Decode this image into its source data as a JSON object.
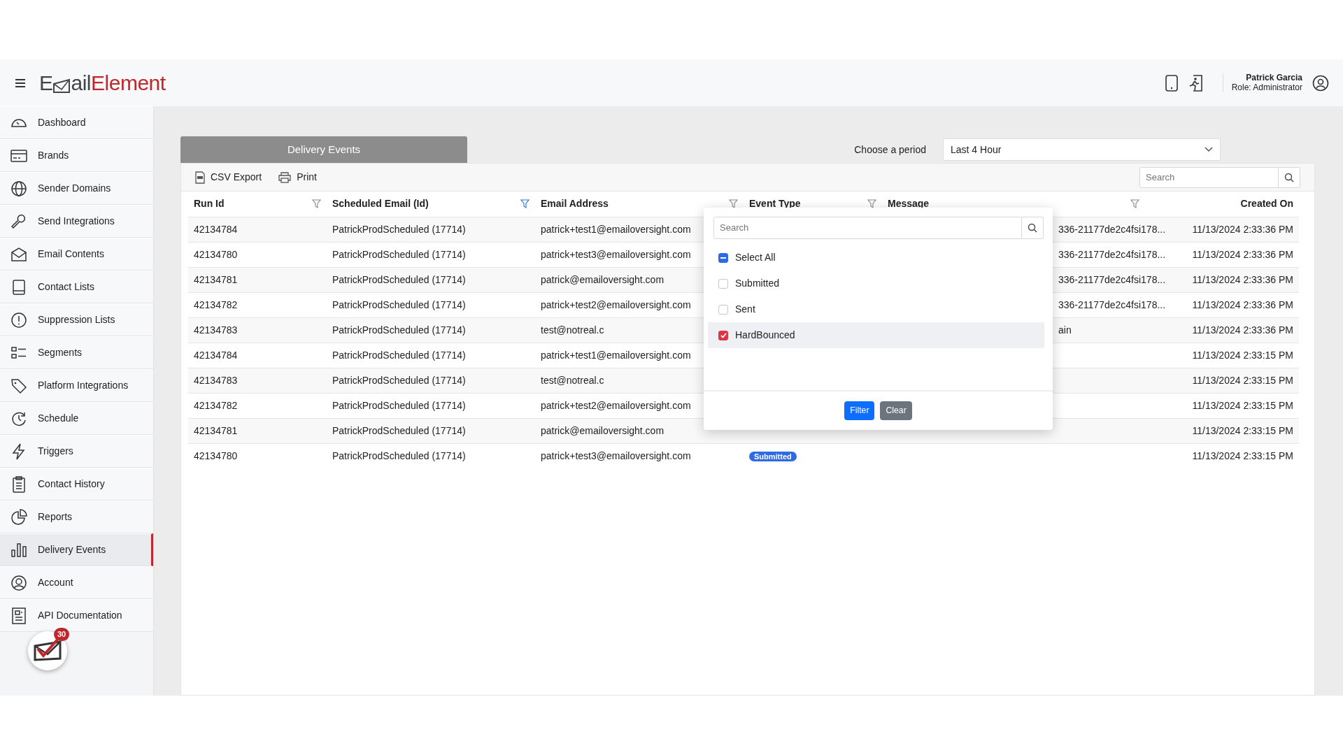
{
  "header": {
    "logo": {
      "start": "E",
      "middle": "ail",
      "end": "Element"
    },
    "user": {
      "name": "Patrick Garcia",
      "role": "Role: Administrator"
    }
  },
  "sidebar": {
    "items": [
      {
        "label": "Dashboard",
        "selected": false
      },
      {
        "label": "Brands",
        "selected": false
      },
      {
        "label": "Sender Domains",
        "selected": false
      },
      {
        "label": "Send Integrations",
        "selected": false
      },
      {
        "label": "Email Contents",
        "selected": false
      },
      {
        "label": "Contact Lists",
        "selected": false
      },
      {
        "label": "Suppression Lists",
        "selected": false
      },
      {
        "label": "Segments",
        "selected": false
      },
      {
        "label": "Platform Integrations",
        "selected": false
      },
      {
        "label": "Schedule",
        "selected": false
      },
      {
        "label": "Triggers",
        "selected": false
      },
      {
        "label": "Contact History",
        "selected": false
      },
      {
        "label": "Reports",
        "selected": false
      },
      {
        "label": "Delivery Events",
        "selected": true
      },
      {
        "label": "Account",
        "selected": false
      },
      {
        "label": "API Documentation",
        "selected": false
      }
    ],
    "notification_count": "30"
  },
  "page": {
    "tab": "Delivery Events",
    "period": {
      "label": "Choose a period",
      "value": "Last 4 Hour"
    }
  },
  "toolbar": {
    "buttons": [
      "CSV Export",
      "Print"
    ],
    "search": {
      "placeholder": "Search"
    }
  },
  "table": {
    "columns": [
      {
        "label": "Run Id",
        "filterable": true,
        "filter_active": false
      },
      {
        "label": "Scheduled Email (Id)",
        "filterable": true,
        "filter_active": true
      },
      {
        "label": "Email Address",
        "filterable": true,
        "filter_active": false
      },
      {
        "label": "Event Type",
        "filterable": true,
        "filter_active": false
      },
      {
        "label": "Message",
        "filterable": true,
        "filter_active": false
      },
      {
        "label": "Created On",
        "filterable": false
      }
    ],
    "rows": [
      {
        "run_id": "42134784",
        "scheduled_email": "PatrickProdScheduled (17714)",
        "email_address": "patrick+test1@emailoversight.com",
        "message": "336-21177de2c4fsi178...",
        "created_on": "11/13/2024 2:33:36 PM"
      },
      {
        "run_id": "42134780",
        "scheduled_email": "PatrickProdScheduled (17714)",
        "email_address": "patrick+test3@emailoversight.com",
        "message": "336-21177de2c4fsi178...",
        "created_on": "11/13/2024 2:33:36 PM"
      },
      {
        "run_id": "42134781",
        "scheduled_email": "PatrickProdScheduled (17714)",
        "email_address": "patrick@emailoversight.com",
        "message": "336-21177de2c4fsi178...",
        "created_on": "11/13/2024 2:33:36 PM"
      },
      {
        "run_id": "42134782",
        "scheduled_email": "PatrickProdScheduled (17714)",
        "email_address": "patrick+test2@emailoversight.com",
        "message": "336-21177de2c4fsi178...",
        "created_on": "11/13/2024 2:33:36 PM"
      },
      {
        "run_id": "42134783",
        "scheduled_email": "PatrickProdScheduled (17714)",
        "email_address": "test@notreal.c",
        "message": "ain",
        "created_on": "11/13/2024 2:33:36 PM"
      },
      {
        "run_id": "42134784",
        "scheduled_email": "PatrickProdScheduled (17714)",
        "email_address": "patrick+test1@emailoversight.com",
        "created_on": "11/13/2024 2:33:15 PM"
      },
      {
        "run_id": "42134783",
        "scheduled_email": "PatrickProdScheduled (17714)",
        "email_address": "test@notreal.c",
        "created_on": "11/13/2024 2:33:15 PM"
      },
      {
        "run_id": "42134782",
        "scheduled_email": "PatrickProdScheduled (17714)",
        "email_address": "patrick+test2@emailoversight.com",
        "created_on": "11/13/2024 2:33:15 PM"
      },
      {
        "run_id": "42134781",
        "scheduled_email": "PatrickProdScheduled (17714)",
        "email_address": "patrick@emailoversight.com",
        "created_on": "11/13/2024 2:33:15 PM"
      },
      {
        "run_id": "42134780",
        "scheduled_email": "PatrickProdScheduled (17714)",
        "email_address": "patrick+test3@emailoversight.com",
        "event_type": "Submitted",
        "created_on": "11/13/2024 2:33:15 PM"
      }
    ]
  },
  "filter_popup": {
    "search": {
      "placeholder": "Search"
    },
    "options": [
      {
        "label": "Select All",
        "indeterminate": true,
        "highlighted": false
      },
      {
        "label": "Submitted",
        "checked": false,
        "indeterminate": false,
        "highlighted": false
      },
      {
        "label": "Sent",
        "checked": false,
        "indeterminate": false,
        "highlighted": false
      },
      {
        "label": "HardBounced",
        "checked": true,
        "indeterminate": false,
        "highlighted": true
      }
    ],
    "buttons": {
      "apply": "Filter",
      "clear": "Clear"
    }
  }
}
